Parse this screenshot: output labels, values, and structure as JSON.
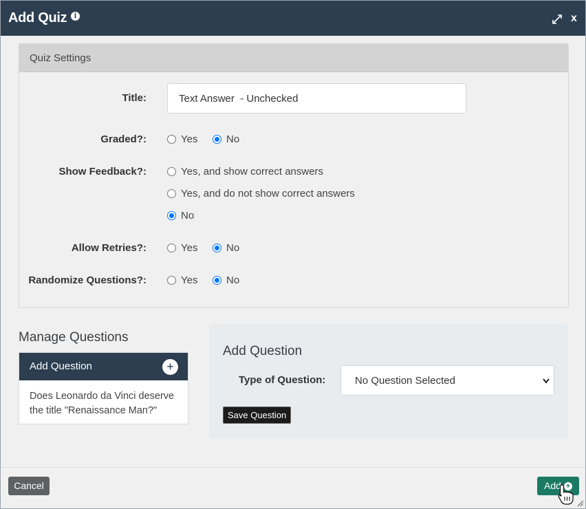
{
  "dialog": {
    "title": "Add Quiz",
    "close_label": "x"
  },
  "settings": {
    "header": "Quiz Settings",
    "title_label": "Title:",
    "title_value": "Text Answer  - Unchecked",
    "graded": {
      "label": "Graded?:",
      "options": [
        "Yes",
        "No"
      ],
      "selected": "No"
    },
    "show_feedback": {
      "label": "Show Feedback?:",
      "options": [
        "Yes, and show correct answers",
        "Yes, and do not show correct answers",
        "No"
      ],
      "selected": "No"
    },
    "allow_retries": {
      "label": "Allow Retries?:",
      "options": [
        "Yes",
        "No"
      ],
      "selected": "No"
    },
    "randomize": {
      "label": "Randomize Questions?:",
      "options": [
        "Yes",
        "No"
      ],
      "selected": "No"
    }
  },
  "manage": {
    "title": "Manage Questions",
    "card_header": "Add Question",
    "plus": "+",
    "questions": [
      "Does Leonardo da Vinci deserve the title \"Renaissance Man?\""
    ]
  },
  "add_question": {
    "heading": "Add Question",
    "type_label": "Type of Question:",
    "type_value": "No Question Selected",
    "save_label": "Save Question"
  },
  "footer": {
    "cancel_label": "Cancel",
    "add_label": "Add"
  },
  "colors": {
    "titlebar": "#2c3e50",
    "add_button": "#1b7a63",
    "cancel_button": "#5d6163",
    "radio_checked": "#0075ff"
  },
  "icons": [
    "info-icon",
    "expand-icon",
    "close-icon",
    "plus-icon",
    "chevron-down-icon",
    "plus-circle-icon",
    "hand-cursor-icon",
    "resize-handle-icon"
  ]
}
